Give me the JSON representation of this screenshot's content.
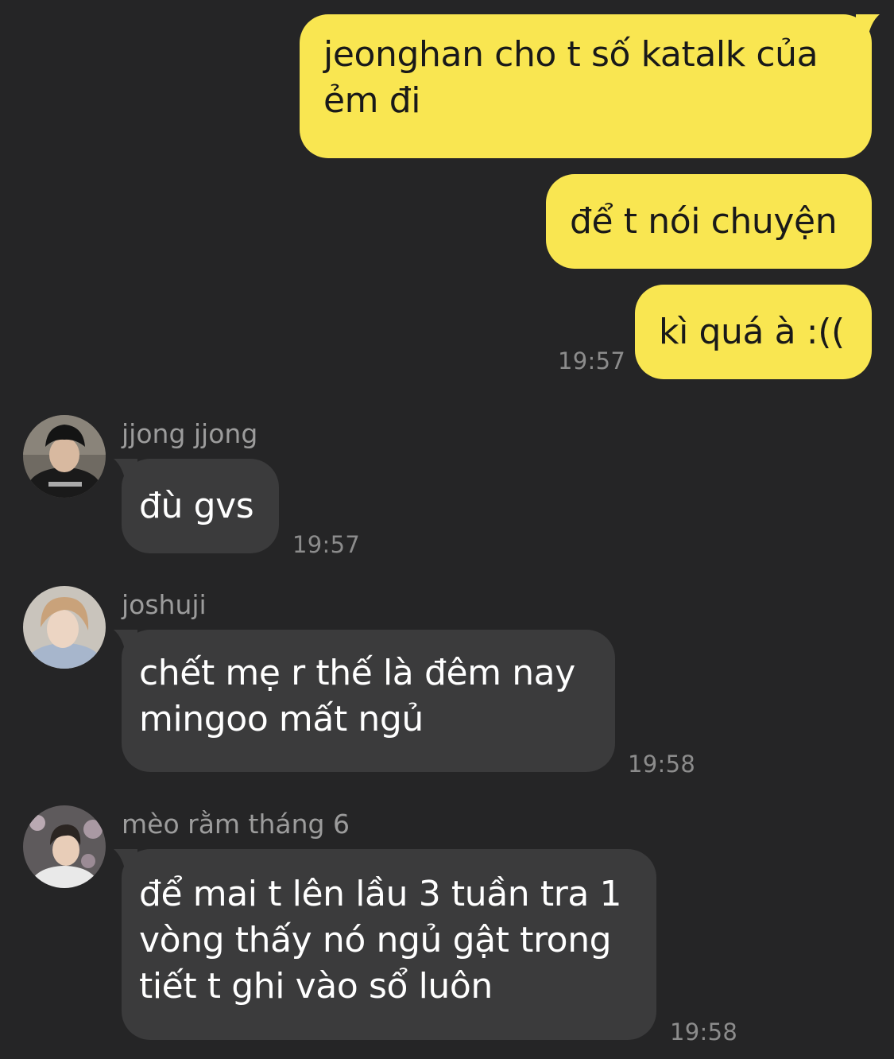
{
  "outgoing": [
    {
      "text_lines": [
        "jeonghan cho t số katalk của",
        "ẻm đi"
      ]
    },
    {
      "text_lines": [
        "để t nói chuyện"
      ]
    },
    {
      "text_lines": [
        "kì quá à :(("
      ],
      "time": "19:57"
    }
  ],
  "incoming": [
    {
      "sender": "jjong jjong",
      "avatar_icon": "avatar-photo-icon",
      "text_lines": [
        "đù gvs"
      ],
      "time": "19:57"
    },
    {
      "sender": "joshuji",
      "avatar_icon": "avatar-photo-icon",
      "text_lines": [
        "chết mẹ r thế là đêm nay",
        "mingoo mất ngủ"
      ],
      "time": "19:58"
    },
    {
      "sender": "mèo rằm tháng 6",
      "avatar_icon": "avatar-photo-icon",
      "text_lines": [
        "để mai t lên lầu 3 tuần tra 1",
        "vòng thấy nó ngủ gật trong",
        "tiết t ghi vào sổ luôn"
      ],
      "time": "19:58"
    }
  ],
  "colors": {
    "background": "#252526",
    "outgoing_bubble": "#f9e651",
    "incoming_bubble": "#3b3b3c",
    "timestamp": "#8c8c8c",
    "sender_name": "#9c9c9c"
  }
}
